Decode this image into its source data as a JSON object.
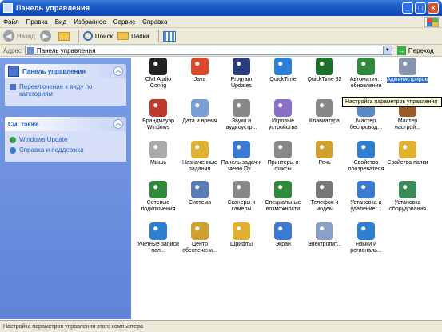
{
  "window": {
    "title": "Панель управления"
  },
  "menu": [
    "Файл",
    "Правка",
    "Вид",
    "Избранное",
    "Сервис",
    "Справка"
  ],
  "toolbar": {
    "back": "Назад",
    "forward": "",
    "search": "Поиск",
    "folders": "Папки"
  },
  "address": {
    "label": "Адрес",
    "value": "Панель управления",
    "go": "Переход"
  },
  "sidebar": {
    "panel1": {
      "title": "Панель управления",
      "items": [
        "Переключение к виду по категориям"
      ]
    },
    "panel2": {
      "title": "См. также",
      "items": [
        "Windows Update",
        "Справка и поддержка"
      ]
    }
  },
  "icons": [
    {
      "label": "CMI Audio Config",
      "icon": "audio-config-icon",
      "color": "#222"
    },
    {
      "label": "Java",
      "icon": "java-icon",
      "color": "#d84a2b"
    },
    {
      "label": "Program Updates",
      "icon": "program-updates-icon",
      "color": "#2a3d7a"
    },
    {
      "label": "QuickTime",
      "icon": "quicktime-icon",
      "color": "#2e7fd8"
    },
    {
      "label": "QuickTime 32",
      "icon": "quicktime32-icon",
      "color": "#1e6f2a"
    },
    {
      "label": "Автоматич... обновление",
      "icon": "auto-update-icon",
      "color": "#2f8a3c"
    },
    {
      "label": "Администрирование",
      "icon": "admin-tools-icon",
      "color": "#6a7a9a"
    },
    {
      "label": "Брандмауэр Windows",
      "icon": "firewall-icon",
      "color": "#c0392b"
    },
    {
      "label": "Дата и время",
      "icon": "clock-icon",
      "color": "#7aa0d8"
    },
    {
      "label": "Звуки и аудиоустр...",
      "icon": "speaker-icon",
      "color": "#888"
    },
    {
      "label": "Игровые устройства",
      "icon": "gamepad-icon",
      "color": "#8a6fc8"
    },
    {
      "label": "Клавиатура",
      "icon": "keyboard-icon",
      "color": "#888"
    },
    {
      "label": "Мастер беспровод...",
      "icon": "wireless-icon",
      "color": "#5a8ac8"
    },
    {
      "label": "Мастер настрой...",
      "icon": "network-wizard-icon",
      "color": "#9a5a2a"
    },
    {
      "label": "Мышь",
      "icon": "mouse-icon",
      "color": "#aaa"
    },
    {
      "label": "Назначенные задания",
      "icon": "tasks-icon",
      "color": "#e0b030"
    },
    {
      "label": "Панель задач и меню Пу...",
      "icon": "taskbar-icon",
      "color": "#3a7ad0"
    },
    {
      "label": "Принтеры и факсы",
      "icon": "printer-icon",
      "color": "#888"
    },
    {
      "label": "Речь",
      "icon": "speech-icon",
      "color": "#d0a030"
    },
    {
      "label": "Свойства обозревателя",
      "icon": "internet-options-icon",
      "color": "#2f7fd0"
    },
    {
      "label": "Свойства папки",
      "icon": "folder-options-icon",
      "color": "#e0b030"
    },
    {
      "label": "Сетевые подключения",
      "icon": "network-icon",
      "color": "#2f8a3c"
    },
    {
      "label": "Система",
      "icon": "system-icon",
      "color": "#5a7ab8"
    },
    {
      "label": "Сканеры и камеры",
      "icon": "scanner-icon",
      "color": "#888"
    },
    {
      "label": "Специальные возможности",
      "icon": "accessibility-icon",
      "color": "#2f8a3c"
    },
    {
      "label": "Телефон и модем",
      "icon": "phone-icon",
      "color": "#777"
    },
    {
      "label": "Установка и удаление ...",
      "icon": "add-remove-icon",
      "color": "#3a7ad0"
    },
    {
      "label": "Установка оборудования",
      "icon": "hardware-icon",
      "color": "#3a8a5a"
    },
    {
      "label": "Учетные записи пол...",
      "icon": "users-icon",
      "color": "#2f7fd0"
    },
    {
      "label": "Центр обеспечени...",
      "icon": "security-center-icon",
      "color": "#d0a030"
    },
    {
      "label": "Шрифты",
      "icon": "fonts-icon",
      "color": "#e0b030"
    },
    {
      "label": "Экран",
      "icon": "display-icon",
      "color": "#3a7ad0"
    },
    {
      "label": "Электропит...",
      "icon": "power-icon",
      "color": "#8aa0c8"
    },
    {
      "label": "Языки и региональ...",
      "icon": "regional-icon",
      "color": "#2f7fd0"
    }
  ],
  "tooltip": "Настройка параметров управления",
  "status": "Настройка параметров управления этого компьютера"
}
